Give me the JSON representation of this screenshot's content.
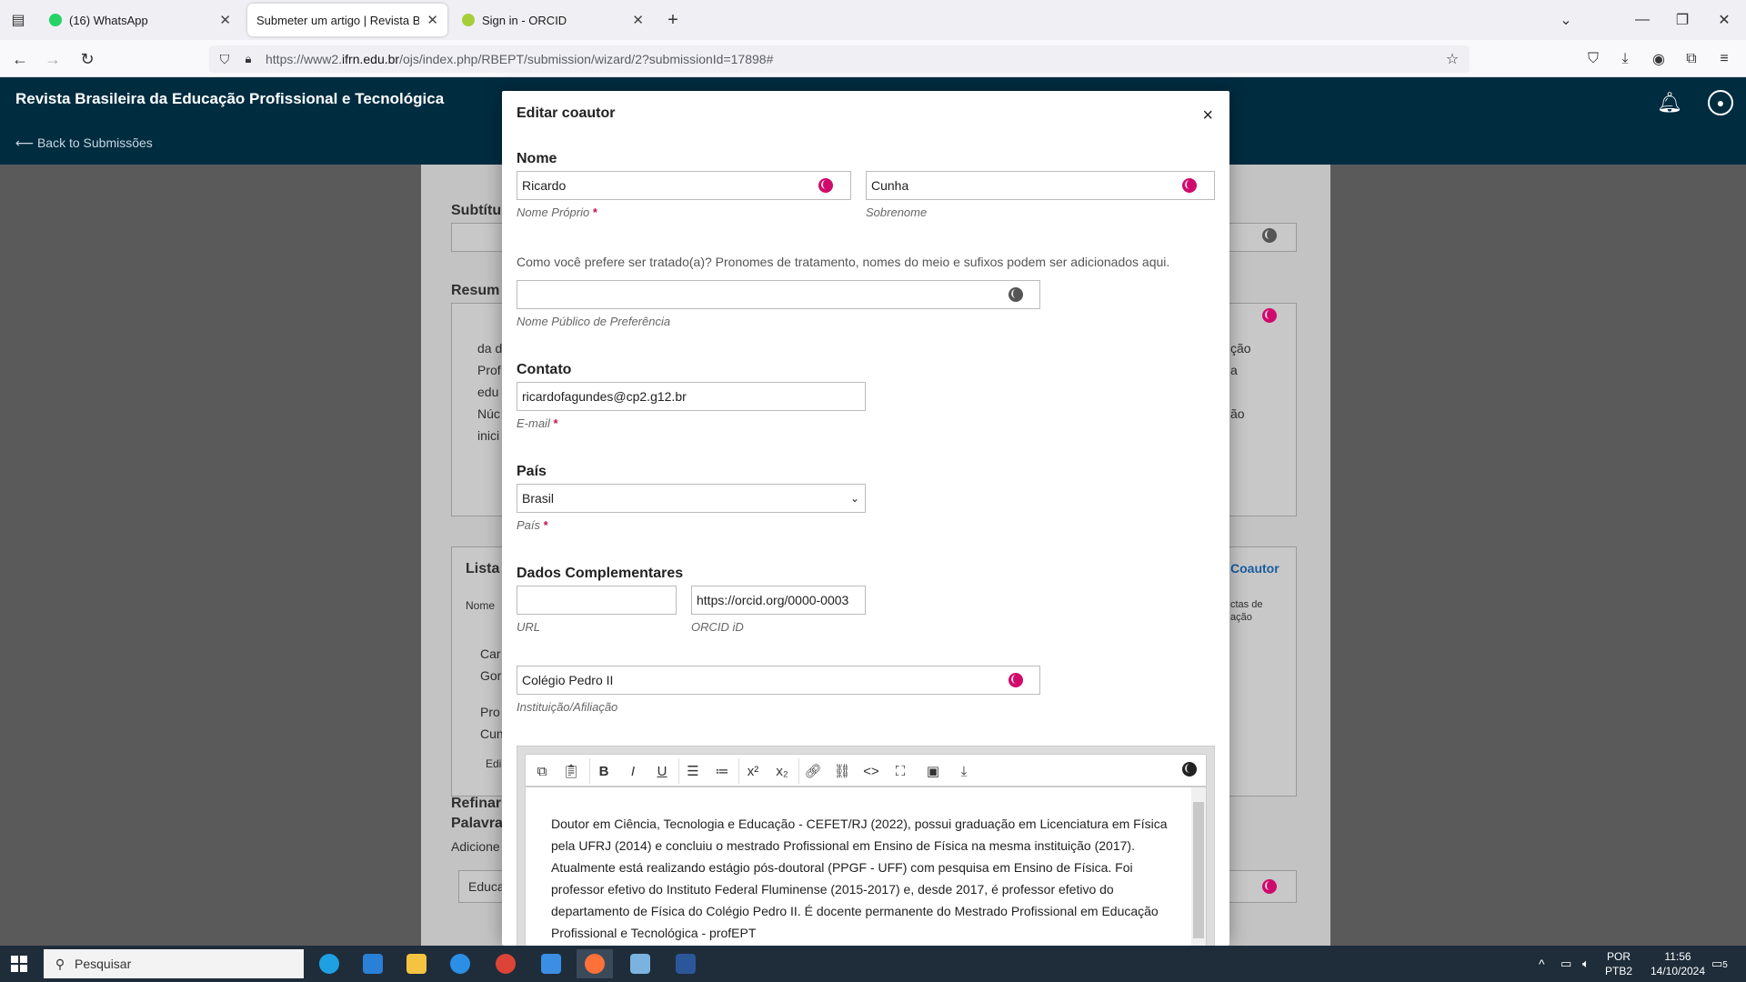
{
  "browser": {
    "tabs": [
      {
        "title": "(16) WhatsApp",
        "favicon_color": "#25d366"
      },
      {
        "title": "Submeter um artigo | Revista Brasile",
        "favicon_color": "#ffffff"
      },
      {
        "title": "Sign in - ORCID",
        "favicon_color": "#a6ce39"
      }
    ],
    "url_prefix": "https://www2.",
    "url_domain": "ifrn.edu.br",
    "url_rest": "/ojs/index.php/RBEPT/submission/wizard/2?submissionId=17898#"
  },
  "site": {
    "title": "Revista Brasileira da Educação Profissional e Tecnológica",
    "back_link": "⟵ Back to Submissões"
  },
  "background": {
    "subtitle_label": "Subtítu",
    "abstract_label": "Resum",
    "abstract_lines": [
      "da d",
      "Prof",
      "edu",
      "Núc",
      "inici"
    ],
    "abstract_right": [
      "ção",
      "a",
      "",
      "ão"
    ],
    "contributors_label": "Lista",
    "add_coauthor": "Coautor",
    "col_name": "Nome",
    "col_right": [
      "ctas de",
      "ação"
    ],
    "row1": [
      "Car",
      "Gor"
    ],
    "row2": [
      "Pro",
      "Cun"
    ],
    "row2_edit": "Edi",
    "refine_label": [
      "Refinar",
      "Palavra"
    ],
    "refine_hint": "Adicione",
    "keyword": "Educa"
  },
  "modal": {
    "title": "Editar coautor",
    "close": "×",
    "name_section": "Nome",
    "given_name": "Ricardo",
    "given_name_label": "Nome Próprio",
    "family_name": "Cunha",
    "family_name_label": "Sobrenome",
    "preferred_desc": "Como você prefere ser tratado(a)? Pronomes de tratamento, nomes do meio e sufixos podem ser adicionados aqui.",
    "preferred_name": "",
    "preferred_name_label": "Nome Público de Preferência",
    "contact_section": "Contato",
    "email": "ricardofagundes@cp2.g12.br",
    "email_label": "E-mail",
    "country_section": "País",
    "country": "Brasil",
    "country_label": "País",
    "extra_section": "Dados Complementares",
    "url": "",
    "url_label": "URL",
    "orcid": "https://orcid.org/0000-0003",
    "orcid_label": "ORCID iD",
    "affiliation": "Colégio Pedro II",
    "affiliation_label": "Instituição/Afiliação",
    "required_mark": "*",
    "bio": "Doutor em Ciência, Tecnologia e Educação - CEFET/RJ (2022), possui graduação em Licenciatura em Física pela UFRJ (2014) e concluiu o mestrado Profissional em Ensino de Física na mesma instituição (2017). Atualmente está realizando estágio pós-doutoral (PPGF - UFF) com pesquisa em Ensino de Física. Foi professor efetivo do Instituto Federal Fluminense (2015-2017) e, desde 2017, é professor efetivo do departamento de Física do Colégio Pedro II. É docente permanente do Mestrado Profissional em Educação Profissional e Tecnológica - profEPT"
  },
  "taskbar": {
    "search_placeholder": "Pesquisar",
    "lang_line1": "POR",
    "lang_line2": "PTB2",
    "time": "11:56",
    "date": "14/10/2024",
    "notifications": "5"
  },
  "colors": {
    "header": "#002c40",
    "required": "#c0174d",
    "globe_active": "#d00a6c"
  }
}
